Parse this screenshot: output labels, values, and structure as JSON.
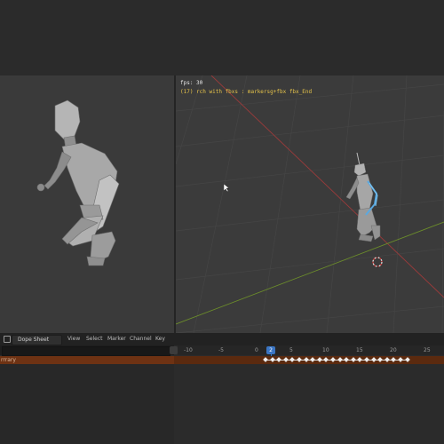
{
  "viewport": {
    "fps_label": "fps: 30",
    "object_label": "(17) rch with fbxs : markersg+fbx fbx_End"
  },
  "timeline": {
    "mode_menu": "Dope Sheet",
    "menus": [
      "View",
      "Select",
      "Marker",
      "Channel",
      "Key"
    ],
    "ruler_ticks": [
      "-10",
      "-5",
      "0",
      "5",
      "10",
      "15",
      "20",
      "25"
    ],
    "current_frame": "2",
    "channel_label": "rrrary"
  },
  "colors": {
    "accent": "#3a75c4",
    "object_label": "#e6c34a",
    "channel": "#6e3213"
  }
}
